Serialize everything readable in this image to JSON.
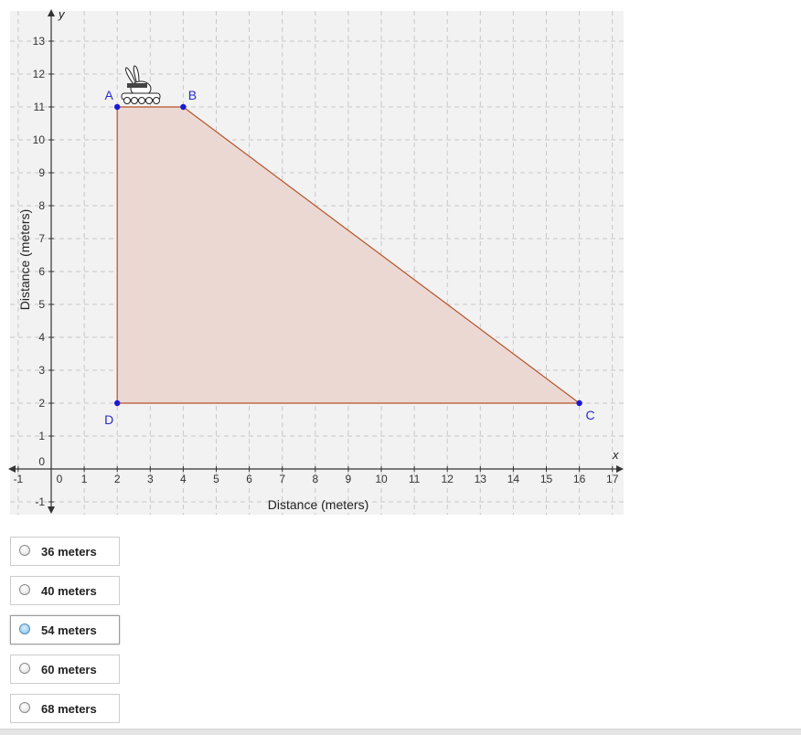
{
  "graph": {
    "x_axis_letter": "x",
    "y_axis_letter": "y",
    "x_label": "Distance (meters)",
    "y_label": "Distance (meters)",
    "x_ticks": [
      "-1",
      "0",
      "1",
      "2",
      "3",
      "4",
      "5",
      "6",
      "7",
      "8",
      "9",
      "10",
      "11",
      "12",
      "13",
      "14",
      "15",
      "16",
      "17"
    ],
    "y_ticks": [
      "-1",
      "0",
      "1",
      "2",
      "3",
      "4",
      "5",
      "6",
      "7",
      "8",
      "9",
      "10",
      "11",
      "12",
      "13"
    ],
    "points": [
      {
        "name": "A",
        "x": 2,
        "y": 11
      },
      {
        "name": "B",
        "x": 4,
        "y": 11
      },
      {
        "name": "C",
        "x": 16,
        "y": 2
      },
      {
        "name": "D",
        "x": 2,
        "y": 2
      }
    ],
    "colors": {
      "background": "#f2f2f2",
      "grid": "#c8c8c8",
      "polygon_fill": "#ecd8d2",
      "polygon_stroke": "#b5532a",
      "point": "#1a1ad6",
      "point_label": "#2a2ad0",
      "axis": "#333333"
    },
    "figure_icon": "bunny-on-tank-icon"
  },
  "choices": [
    {
      "label": "36 meters",
      "selected": false
    },
    {
      "label": "40 meters",
      "selected": false
    },
    {
      "label": "54 meters",
      "selected": true
    },
    {
      "label": "60 meters",
      "selected": false
    },
    {
      "label": "68 meters",
      "selected": false
    }
  ]
}
